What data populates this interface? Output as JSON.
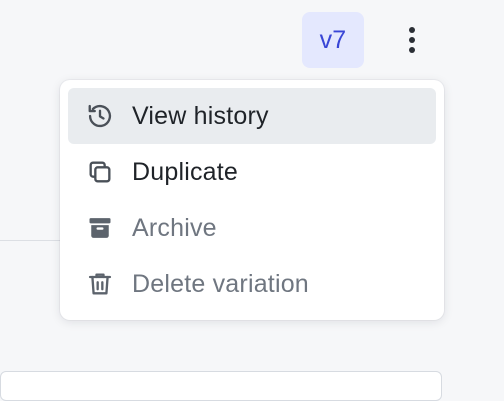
{
  "version_badge": {
    "label": "v7",
    "text_color": "#3946d6",
    "background": "#e4e8fe"
  },
  "kebab_button": {
    "icon": "more-vertical-icon"
  },
  "menu": {
    "items": [
      {
        "label": "View history",
        "icon": "history-icon",
        "state": "hovered"
      },
      {
        "label": "Duplicate",
        "icon": "duplicate-icon",
        "state": "enabled"
      },
      {
        "label": "Archive",
        "icon": "archive-icon",
        "state": "disabled"
      },
      {
        "label": "Delete variation",
        "icon": "trash-icon",
        "state": "disabled"
      }
    ]
  }
}
